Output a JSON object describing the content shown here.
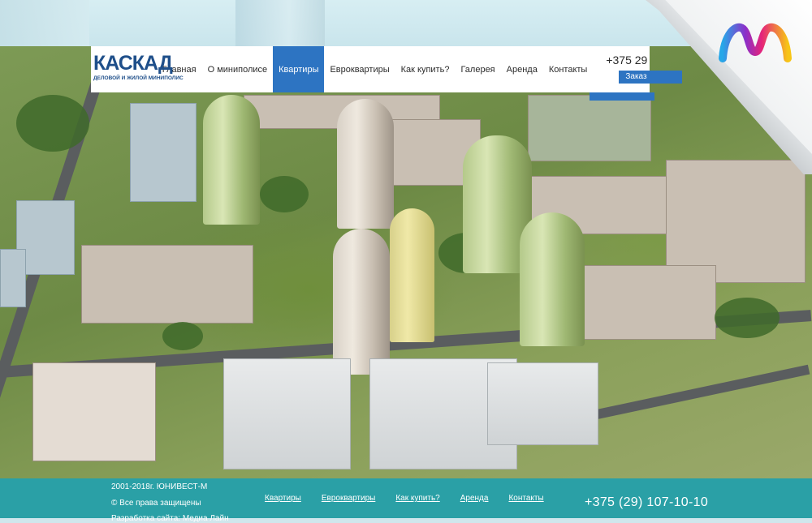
{
  "header": {
    "logo_word": "КАСКАД",
    "logo_subtitle": "ДЕЛОВОЙ И ЖИЛОЙ МИНИПОЛИС",
    "nav": [
      {
        "label": "Главная",
        "active": false
      },
      {
        "label": "О миниполисе",
        "active": false
      },
      {
        "label": "Квартиры",
        "active": true
      },
      {
        "label": "Евроквартиры",
        "active": false
      },
      {
        "label": "Как купить?",
        "active": false
      },
      {
        "label": "Галерея",
        "active": false
      },
      {
        "label": "Аренда",
        "active": false
      },
      {
        "label": "Контакты",
        "active": false
      }
    ],
    "phone": "+375 29",
    "order_label": "Заказ"
  },
  "footer": {
    "copyright": "2001-2018г. ЮНИВЕСТ-М",
    "rights": "© Все права защищены",
    "developer": "Разработка сайта: Медиа Лайн",
    "links": [
      "Квартиры",
      "Евроквартиры",
      "Как купить?",
      "Аренда",
      "Контакты"
    ],
    "phone": "+375 (29) 107-10-10"
  },
  "colors": {
    "accent": "#2d74c2",
    "footer_bg": "#2aa0a6",
    "logo": "#1f4f8a"
  },
  "icons": {
    "corner_brand": "m-brand-logo-icon"
  }
}
